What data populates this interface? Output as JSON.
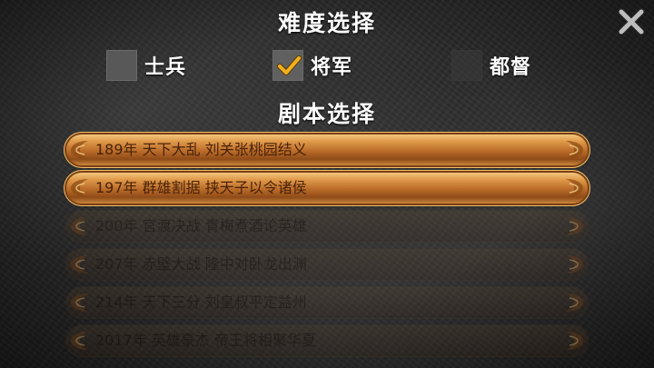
{
  "difficulty": {
    "title": "难度选择",
    "options": [
      {
        "label": "士兵",
        "checked": false,
        "enabled": true
      },
      {
        "label": "将军",
        "checked": true,
        "enabled": true
      },
      {
        "label": "都督",
        "checked": false,
        "enabled": false
      }
    ]
  },
  "scenarios": {
    "title": "剧本选择",
    "items": [
      {
        "label": "189年 天下大乱 刘关张桃园结义",
        "active": true
      },
      {
        "label": "197年 群雄割据 挟天子以令诸侯",
        "active": true
      },
      {
        "label": "200年 官渡决战 青梅煮酒论英雄",
        "active": false
      },
      {
        "label": "207年 赤壁大战 隆中对卧龙出渊",
        "active": false
      },
      {
        "label": "214年 天下三分 刘皇叔平定益州",
        "active": false
      },
      {
        "label": "2017年 英雄豪杰 帝王将相聚华夏",
        "active": false
      }
    ]
  },
  "colors": {
    "checkmark": "#f0b020",
    "active_bar": "#d08a40",
    "label_text": "#4a2208"
  },
  "icons": {
    "close": "close-icon",
    "check": "checkmark-icon"
  }
}
